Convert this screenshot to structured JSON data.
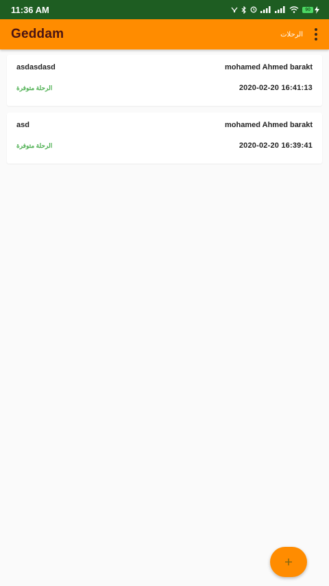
{
  "status_bar": {
    "time": "11:36 AM",
    "battery_label": "90"
  },
  "app_bar": {
    "title": "Geddam",
    "trips_label": "الرحلات"
  },
  "trips": [
    {
      "name": "asdasdasd",
      "driver": "mohamed Ahmed barakt",
      "status": "الرحلة متوفرة",
      "date": "2020-02-20 16:41:13"
    },
    {
      "name": "asd",
      "driver": "mohamed Ahmed barakt",
      "status": "الرحلة متوفرة",
      "date": "2020-02-20 16:39:41"
    }
  ],
  "fab": {
    "icon": "plus-icon"
  },
  "colors": {
    "status_bar": "#1e5d22",
    "app_bar": "#ff8c00",
    "title": "#4a1414",
    "status_green": "#4caf50"
  }
}
